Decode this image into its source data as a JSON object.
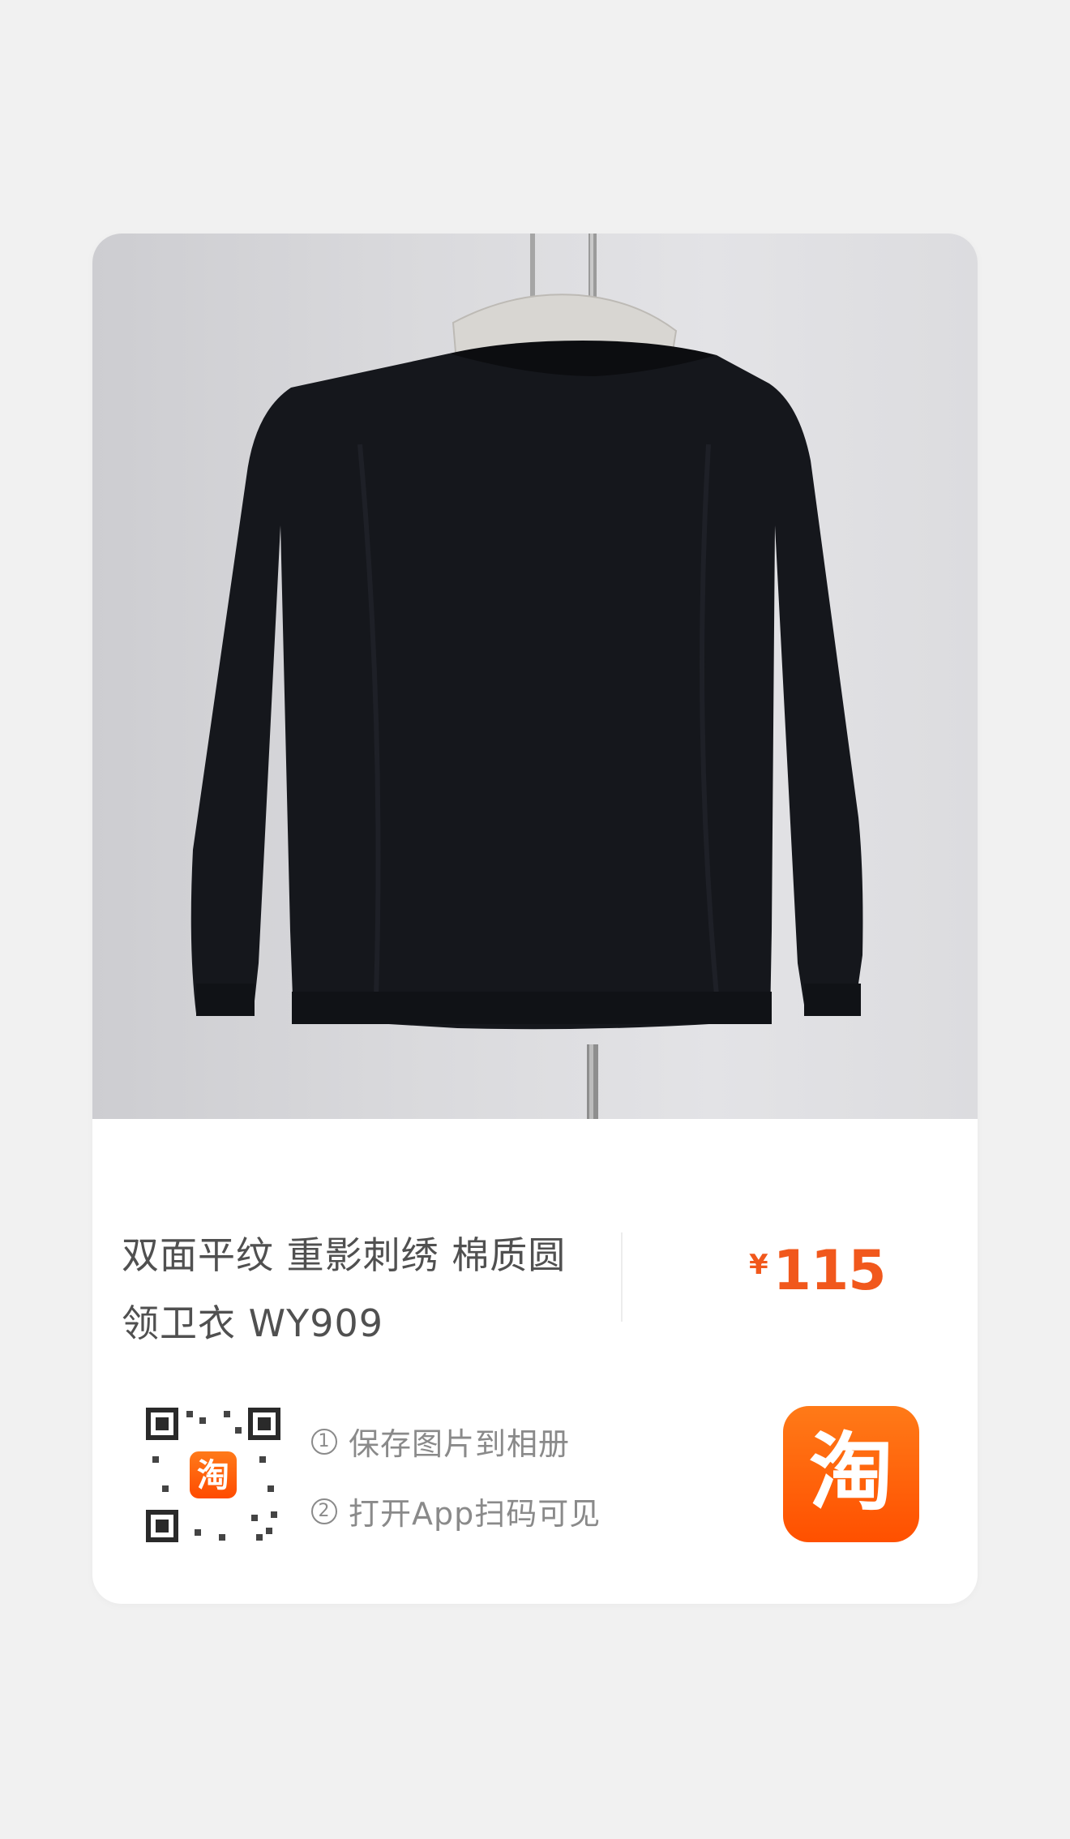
{
  "product": {
    "title_line1": "双面平纹 重影刺绣 棉质圆",
    "title_line2": "领卫衣 WY909",
    "currency": "¥",
    "price": "115"
  },
  "share": {
    "step1_num": "1",
    "step1_label": "保存图片到相册",
    "step2_num": "2",
    "step2_label": "打开App扫码可见"
  },
  "app": {
    "icon_glyph": "淘",
    "qr_logo_glyph": "淘",
    "accent_color": "#ff5000",
    "price_color": "#f1581c"
  },
  "icons": [
    "qr-code-icon",
    "taobao-app-icon"
  ]
}
